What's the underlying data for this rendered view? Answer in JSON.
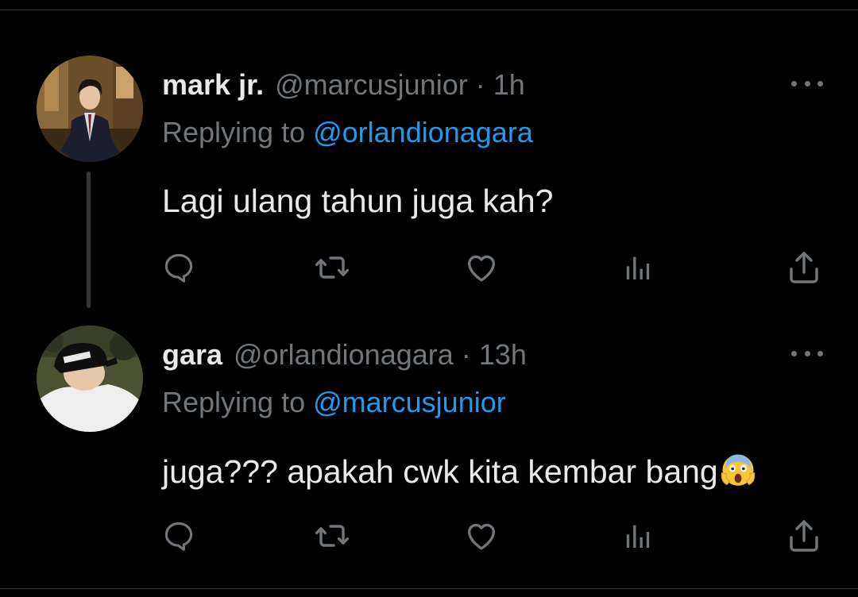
{
  "tweets": [
    {
      "name": "mark jr.",
      "handle": "@marcusjunior",
      "separator": "·",
      "time": "1h",
      "replying_prefix": "Replying to",
      "replying_to": "@orlandionagara",
      "text": "Lagi ulang tahun juga kah?"
    },
    {
      "name": "gara",
      "handle": "@orlandionagara",
      "separator": "·",
      "time": "13h",
      "replying_prefix": "Replying to",
      "replying_to": "@marcusjunior",
      "text": "juga??? apakah cwk kita kembar bang"
    }
  ],
  "colors": {
    "background": "#000000",
    "text_primary": "#e7e9ea",
    "text_secondary": "#71767b",
    "accent": "#1d9bf0",
    "divider": "#2f3336"
  },
  "icons": {
    "reply": "comment-bubble-icon",
    "retweet": "retweet-icon",
    "like": "heart-icon",
    "views": "analytics-bars-icon",
    "share": "share-upload-icon",
    "more": "more-dots-icon",
    "emoji": "face-screaming-in-fear-emoji"
  }
}
